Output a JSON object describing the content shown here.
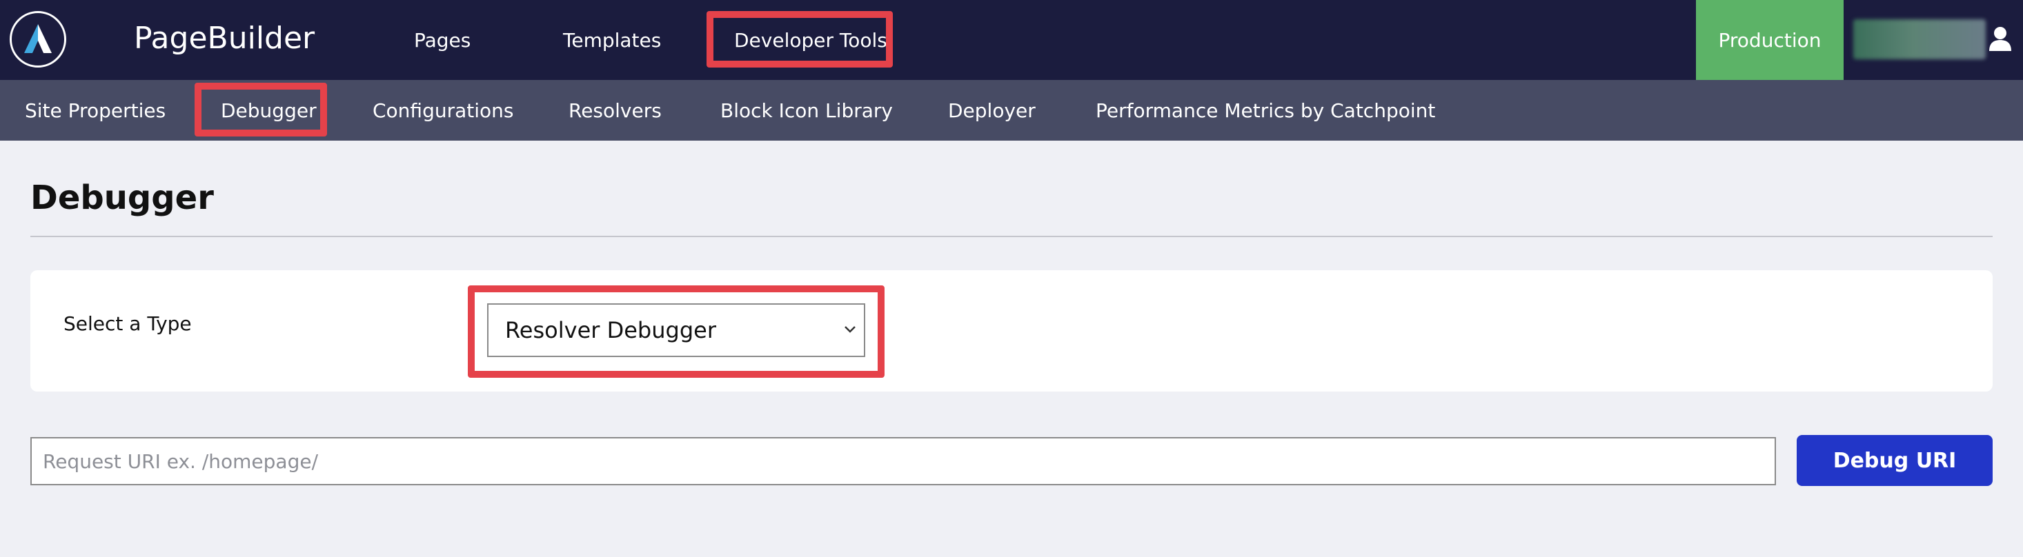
{
  "header": {
    "brand": "PageBuilder",
    "nav": [
      {
        "label": "Pages"
      },
      {
        "label": "Templates"
      },
      {
        "label": "Developer Tools",
        "highlighted": true
      }
    ],
    "environment": "Production",
    "icons": {
      "logo": "logo-icon",
      "user": "user-icon"
    }
  },
  "subnav": {
    "items": [
      {
        "label": "Site Properties"
      },
      {
        "label": "Debugger",
        "highlighted": true
      },
      {
        "label": "Configurations"
      },
      {
        "label": "Resolvers"
      },
      {
        "label": "Block Icon Library"
      },
      {
        "label": "Deployer"
      },
      {
        "label": "Performance Metrics by Catchpoint"
      }
    ]
  },
  "main": {
    "title": "Debugger",
    "type_selector": {
      "label": "Select a Type",
      "selected": "Resolver Debugger",
      "icon": "chevron-down-icon"
    },
    "uri": {
      "value": "",
      "placeholder": "Request URI ex. /homepage/"
    },
    "debug_button": "Debug URI"
  },
  "colors": {
    "header_bg": "#1b1c3e",
    "subnav_bg": "#474b64",
    "page_bg": "#eff0f5",
    "highlight": "#e5424a",
    "environment": "#5cb367",
    "primary_button": "#2236c8"
  }
}
